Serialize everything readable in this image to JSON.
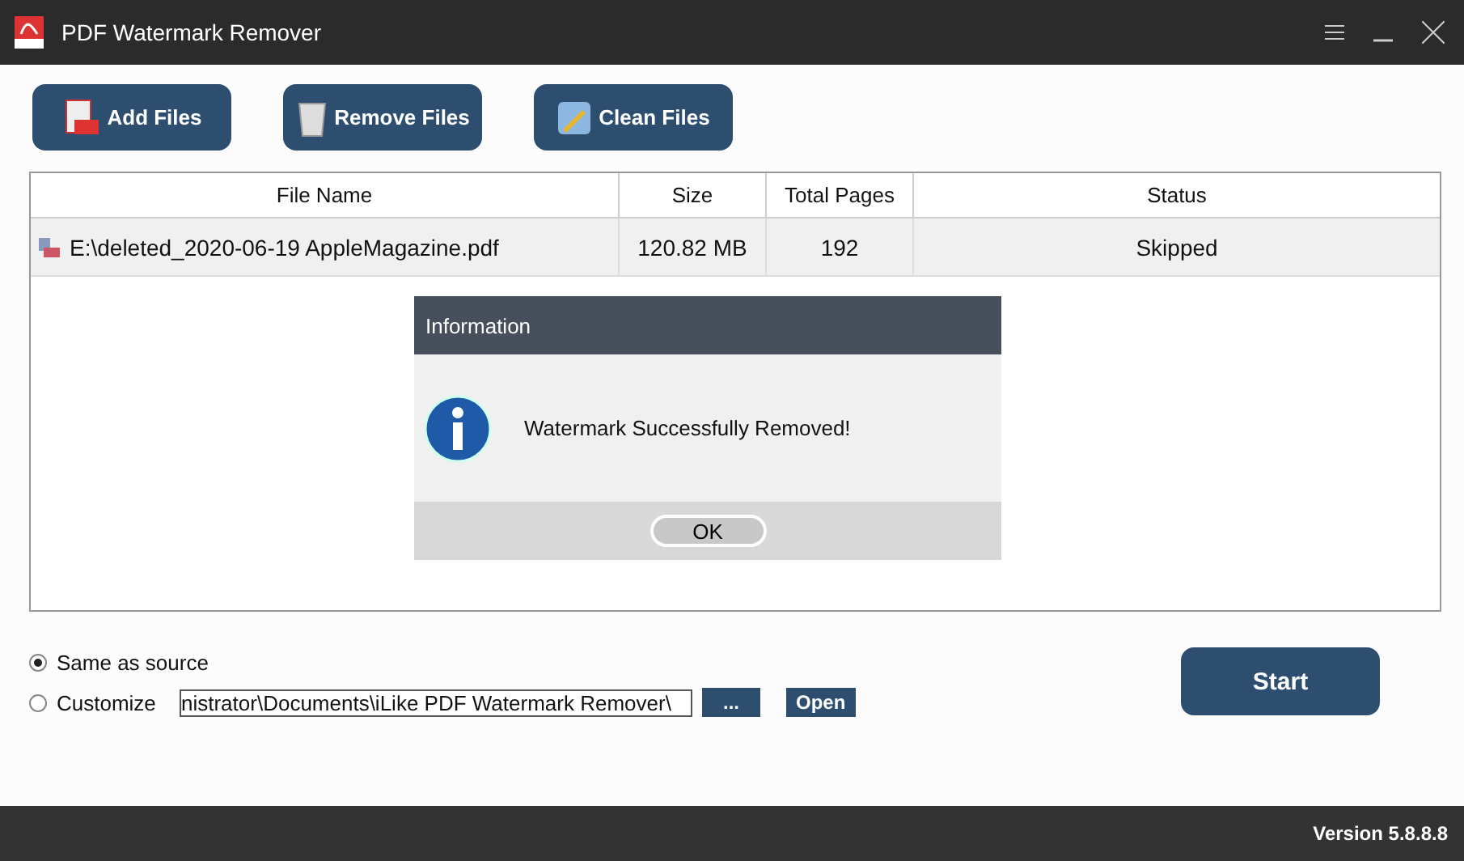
{
  "window": {
    "title": "PDF Watermark Remover"
  },
  "toolbar": [
    {
      "kind": "add",
      "label": "Add Files"
    },
    {
      "kind": "remove",
      "label": "Remove Files"
    },
    {
      "kind": "clean",
      "label": "Clean Files"
    }
  ],
  "table": {
    "columns": [
      "File Name",
      "Size",
      "Total Pages",
      "Status"
    ],
    "rows": [
      {
        "selected": true,
        "cells": [
          "E:\\deleted_2020-06-19 AppleMagazine.pdf",
          "120.82 MB",
          "192",
          "Skipped"
        ]
      }
    ]
  },
  "dialog": {
    "title": "Information",
    "message": "Watermark Successfully Removed!",
    "button": "OK"
  },
  "output": {
    "options": [
      {
        "label": "Same as source",
        "selected": true
      },
      {
        "label": "Customize",
        "selected": false
      }
    ],
    "path": "nistrator\\Documents\\iLike PDF Watermark Remover\\",
    "browse": "...",
    "open": "Open"
  },
  "start": "Start",
  "status_bar": {
    "version": "Version 5.8.8.8"
  }
}
